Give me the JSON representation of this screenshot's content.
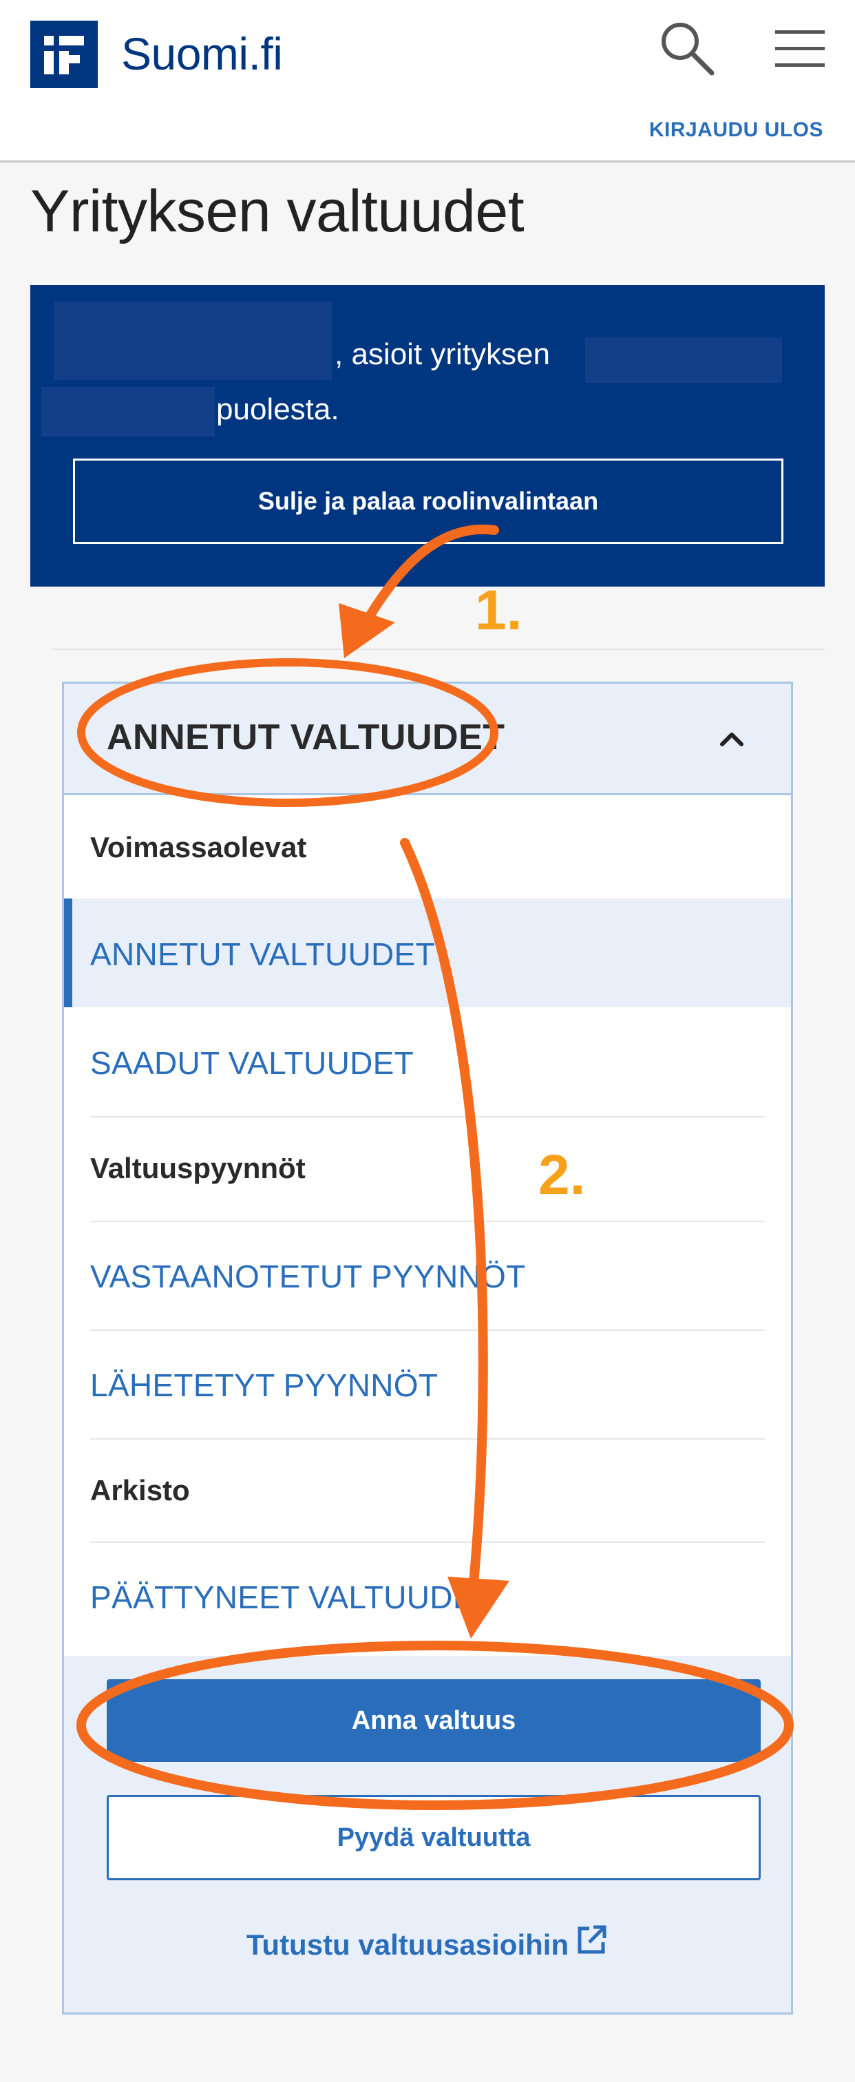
{
  "header": {
    "logo_text": "Suomi.fi",
    "logout_label": "KIRJAUDU ULOS",
    "search_icon": "search-icon",
    "menu_icon": "hamburger-menu-icon"
  },
  "page_title": "Yrityksen valtuudet",
  "banner": {
    "text_part1": ", asioit yrityksen",
    "text_part2": "puolesta.",
    "close_button_label": "Sulje ja palaa roolinvalintaan"
  },
  "nav": {
    "accordion_title": "ANNETUT VALTUUDET",
    "sections": [
      {
        "label": "Voimassaolevat",
        "items": [
          "ANNETUT VALTUUDET",
          "SAADUT VALTUUDET"
        ]
      },
      {
        "label": "Valtuuspyynnöt",
        "items": [
          "VASTAANOTETUT PYYNNÖT",
          "LÄHETETYT PYYNNÖT"
        ]
      },
      {
        "label": "Arkisto",
        "items": [
          "PÄÄTTYNEET VALTUUDET"
        ]
      }
    ],
    "active_item": "ANNETUT VALTUUDET"
  },
  "actions": {
    "primary_label": "Anna valtuus",
    "secondary_label": "Pyydä valtuutta",
    "learn_link_label": "Tutustu valtuusasioihin"
  },
  "annotations": {
    "step1": "1.",
    "step2": "2."
  },
  "colors": {
    "brand_navy": "#003580",
    "link_blue": "#2a6ebb",
    "annotation_orange": "#f46b1e",
    "annotation_number": "#f7a11b"
  }
}
